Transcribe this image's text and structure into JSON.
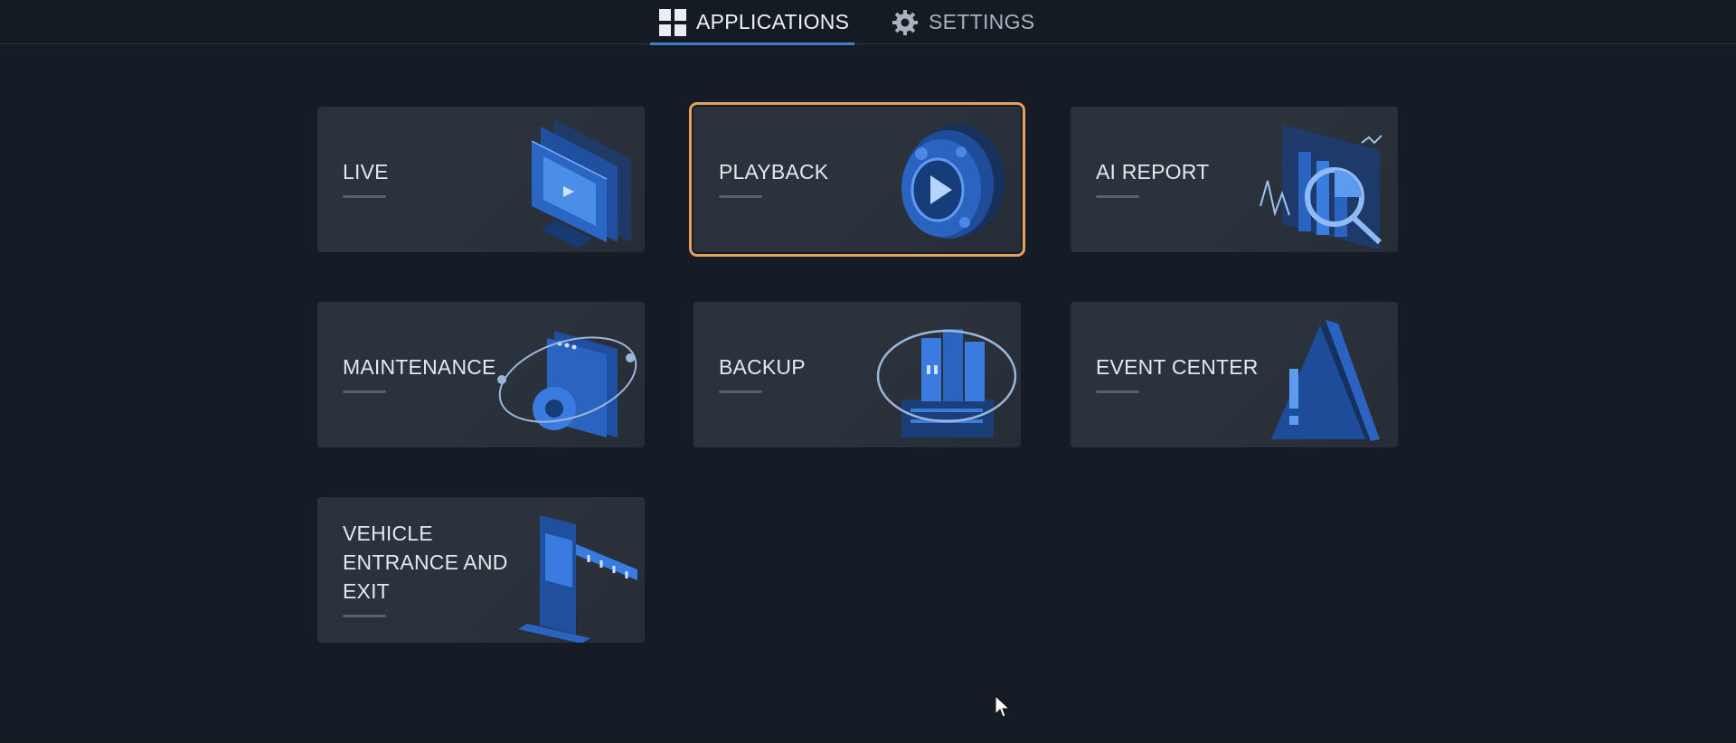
{
  "tabs": [
    {
      "label": "APPLICATIONS",
      "icon": "grid-icon",
      "active": true
    },
    {
      "label": "SETTINGS",
      "icon": "gear-icon",
      "active": false
    }
  ],
  "apps": [
    {
      "label": "LIVE",
      "icon": "monitor-icon"
    },
    {
      "label": "PLAYBACK",
      "icon": "playback-reel-icon",
      "focused": true
    },
    {
      "label": "AI REPORT",
      "icon": "chart-report-icon"
    },
    {
      "label": "MAINTENANCE",
      "icon": "maintenance-gear-icon"
    },
    {
      "label": "BACKUP",
      "icon": "backup-drive-icon"
    },
    {
      "label": "EVENT CENTER",
      "icon": "alert-triangle-icon"
    },
    {
      "label": "VEHICLE ENTRANCE AND EXIT",
      "icon": "barrier-gate-icon"
    }
  ],
  "colors": {
    "background": "#161c25",
    "card": "#2b323c",
    "accent_blue": "#3f7fd0",
    "focus_orange": "#e8a060"
  }
}
